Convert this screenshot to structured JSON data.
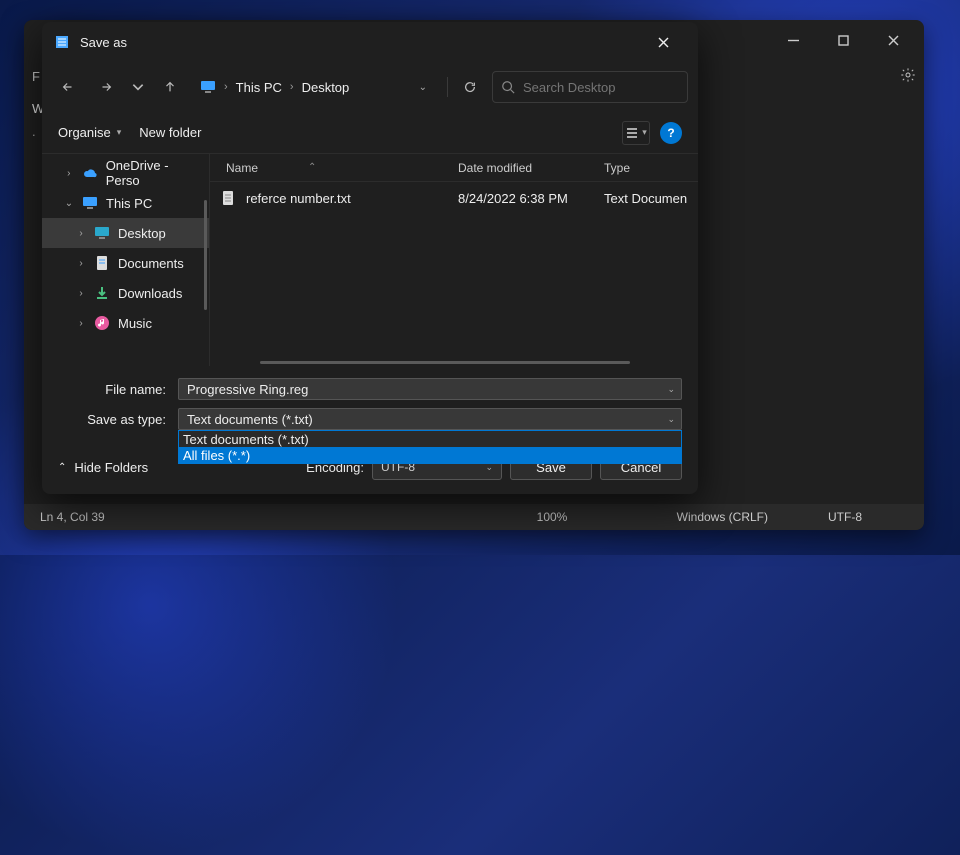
{
  "notepad": {
    "menu_file_letter": "F",
    "menu_w_letter": "W",
    "status_cursor": "Ln 4, Col 39",
    "status_zoom": "100%",
    "status_lineend": "Windows (CRLF)",
    "status_encoding": "UTF-8"
  },
  "dialog": {
    "title": "Save as",
    "breadcrumb": {
      "root": "This PC",
      "leaf": "Desktop"
    },
    "search_placeholder": "Search Desktop",
    "toolbar": {
      "organise": "Organise",
      "newfolder": "New folder",
      "help": "?"
    },
    "columns": {
      "name": "Name",
      "date": "Date modified",
      "type": "Type"
    },
    "sidebar": {
      "items": [
        {
          "label": "OneDrive - Perso",
          "icon": "cloud",
          "chevron": "right",
          "depth": 0
        },
        {
          "label": "This PC",
          "icon": "pc",
          "chevron": "down",
          "depth": 0
        },
        {
          "label": "Desktop",
          "icon": "desktop",
          "chevron": "right",
          "depth": 1,
          "active": true
        },
        {
          "label": "Documents",
          "icon": "doc",
          "chevron": "right",
          "depth": 1
        },
        {
          "label": "Downloads",
          "icon": "download",
          "chevron": "right",
          "depth": 1
        },
        {
          "label": "Music",
          "icon": "music",
          "chevron": "right",
          "depth": 1
        }
      ]
    },
    "files": [
      {
        "name": "referce number.txt",
        "date": "8/24/2022 6:38 PM",
        "type": "Text Documen"
      }
    ],
    "filename_label": "File name:",
    "filename_value": "Progressive Ring.reg",
    "savetype_label": "Save as type:",
    "savetype_value": "Text documents (*.txt)",
    "type_options": [
      "Text documents (*.txt)",
      "All files  (*.*)"
    ],
    "hide_folders": "Hide Folders",
    "encoding_label": "Encoding:",
    "encoding_value": "UTF-8",
    "save_label": "Save",
    "cancel_label": "Cancel"
  }
}
